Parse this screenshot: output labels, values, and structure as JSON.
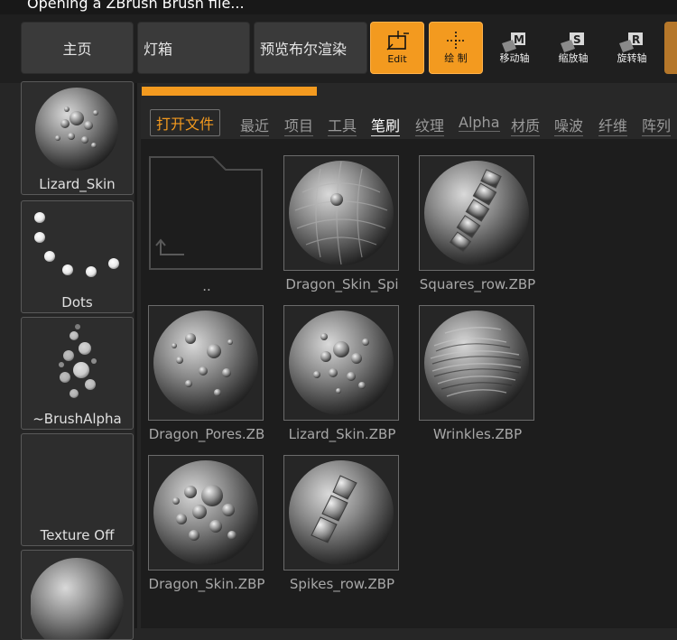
{
  "window": {
    "title": "Opening a ZBrush Brush file..."
  },
  "topbar": {
    "nav": [
      {
        "label": "主页"
      },
      {
        "label": "灯箱"
      },
      {
        "label": "预览布尔渲染"
      }
    ],
    "tools": [
      {
        "label": "Edit",
        "icon": "edit-icon",
        "active": true
      },
      {
        "label": "绘 制",
        "icon": "draw-icon",
        "active": true
      },
      {
        "label": "移动轴",
        "icon": "move-gizmo-icon",
        "key": "M"
      },
      {
        "label": "缩放轴",
        "icon": "scale-gizmo-icon",
        "key": "S"
      },
      {
        "label": "旋转轴",
        "icon": "rotate-gizmo-icon",
        "key": "R"
      }
    ],
    "accent": "#f39a1f"
  },
  "sidebar": {
    "items": [
      {
        "label": "Lizard_Skin",
        "thumb": "lizard-skin-sphere"
      },
      {
        "label": "Dots",
        "thumb": "dots-stroke"
      },
      {
        "label": "~BrushAlpha",
        "thumb": "brush-alpha-bubbles"
      },
      {
        "label": "Texture Off",
        "thumb": "blank"
      },
      {
        "label": "",
        "thumb": "material-sphere"
      }
    ]
  },
  "lightbox": {
    "open_file_label": "打开文件",
    "tabs": [
      {
        "label": "最近"
      },
      {
        "label": "项目"
      },
      {
        "label": "工具"
      },
      {
        "label": "笔刷",
        "active": true
      },
      {
        "label": "纹理"
      },
      {
        "label": "Alpha"
      },
      {
        "label": "材质"
      },
      {
        "label": "噪波"
      },
      {
        "label": "纤维"
      },
      {
        "label": "阵列"
      }
    ],
    "files": [
      {
        "name": "..",
        "kind": "folder-up"
      },
      {
        "name": "Dragon_Skin_Spi",
        "kind": "dragon-skin-spikes"
      },
      {
        "name": "Squares_row.ZBP",
        "kind": "squares-row"
      },
      {
        "name": "Dragon_Pores.ZB",
        "kind": "dragon-pores"
      },
      {
        "name": "Lizard_Skin.ZBP",
        "kind": "lizard-skin"
      },
      {
        "name": "Wrinkles.ZBP",
        "kind": "wrinkles"
      },
      {
        "name": "Dragon_Skin.ZBP",
        "kind": "dragon-skin"
      },
      {
        "name": "Spikes_row.ZBP",
        "kind": "spikes-row"
      }
    ]
  }
}
